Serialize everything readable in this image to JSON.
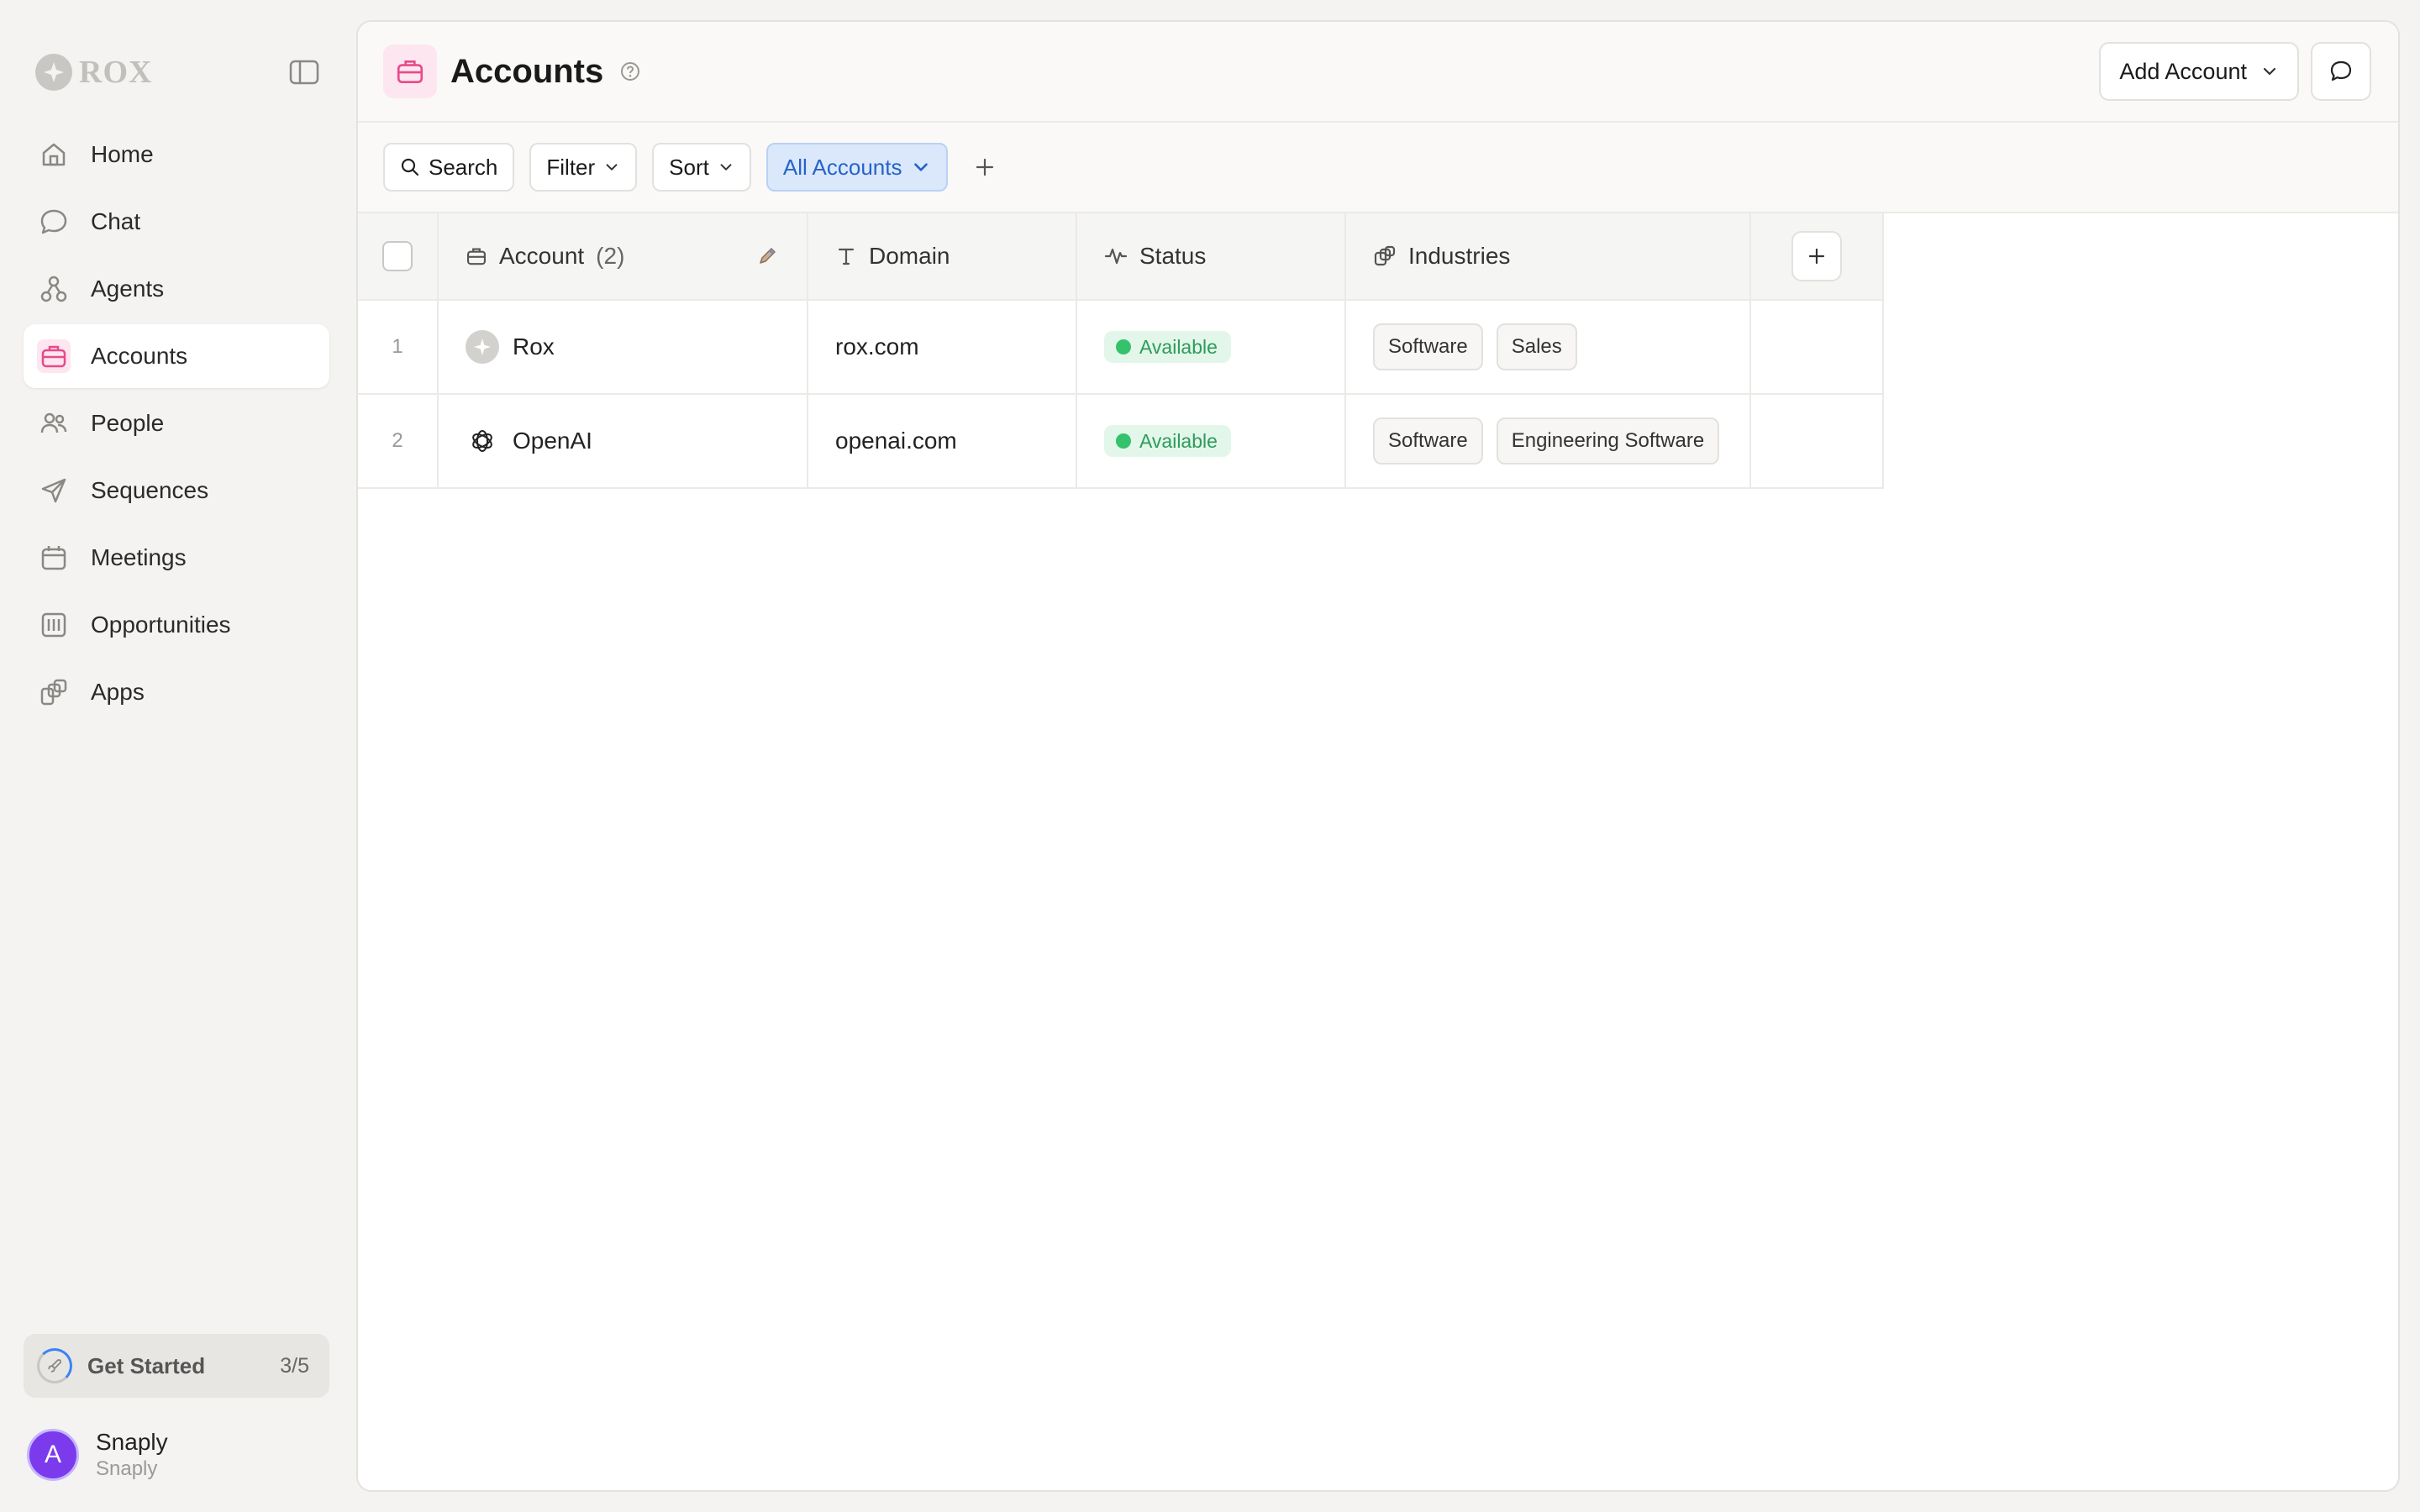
{
  "brand": {
    "name": "ROX"
  },
  "sidebar": {
    "items": [
      {
        "label": "Home",
        "icon": "home-icon",
        "active": false
      },
      {
        "label": "Chat",
        "icon": "chat-icon",
        "active": false
      },
      {
        "label": "Agents",
        "icon": "agents-icon",
        "active": false
      },
      {
        "label": "Accounts",
        "icon": "briefcase-icon",
        "active": true
      },
      {
        "label": "People",
        "icon": "people-icon",
        "active": false
      },
      {
        "label": "Sequences",
        "icon": "send-icon",
        "active": false
      },
      {
        "label": "Meetings",
        "icon": "calendar-icon",
        "active": false
      },
      {
        "label": "Opportunities",
        "icon": "columns-icon",
        "active": false
      },
      {
        "label": "Apps",
        "icon": "apps-icon",
        "active": false
      }
    ],
    "get_started": {
      "label": "Get Started",
      "count": "3/5"
    },
    "user": {
      "avatar_letter": "A",
      "name": "Snaply",
      "org": "Snaply"
    }
  },
  "header": {
    "title": "Accounts",
    "add_button": "Add Account"
  },
  "toolbar": {
    "search": "Search",
    "filter": "Filter",
    "sort": "Sort",
    "view": "All Accounts"
  },
  "table": {
    "columns": {
      "account": "Account",
      "account_count": "(2)",
      "domain": "Domain",
      "status": "Status",
      "industries": "Industries"
    },
    "rows": [
      {
        "num": "1",
        "name": "Rox",
        "domain": "rox.com",
        "status": "Available",
        "industries": [
          "Software",
          "Sales"
        ]
      },
      {
        "num": "2",
        "name": "OpenAI",
        "domain": "openai.com",
        "status": "Available",
        "industries": [
          "Software",
          "Engineering Software"
        ]
      }
    ]
  },
  "colors": {
    "accent_pink": "#e84a8a",
    "view_blue": "#2563c9",
    "status_green": "#35c26c",
    "avatar_purple": "#7c3aed"
  }
}
